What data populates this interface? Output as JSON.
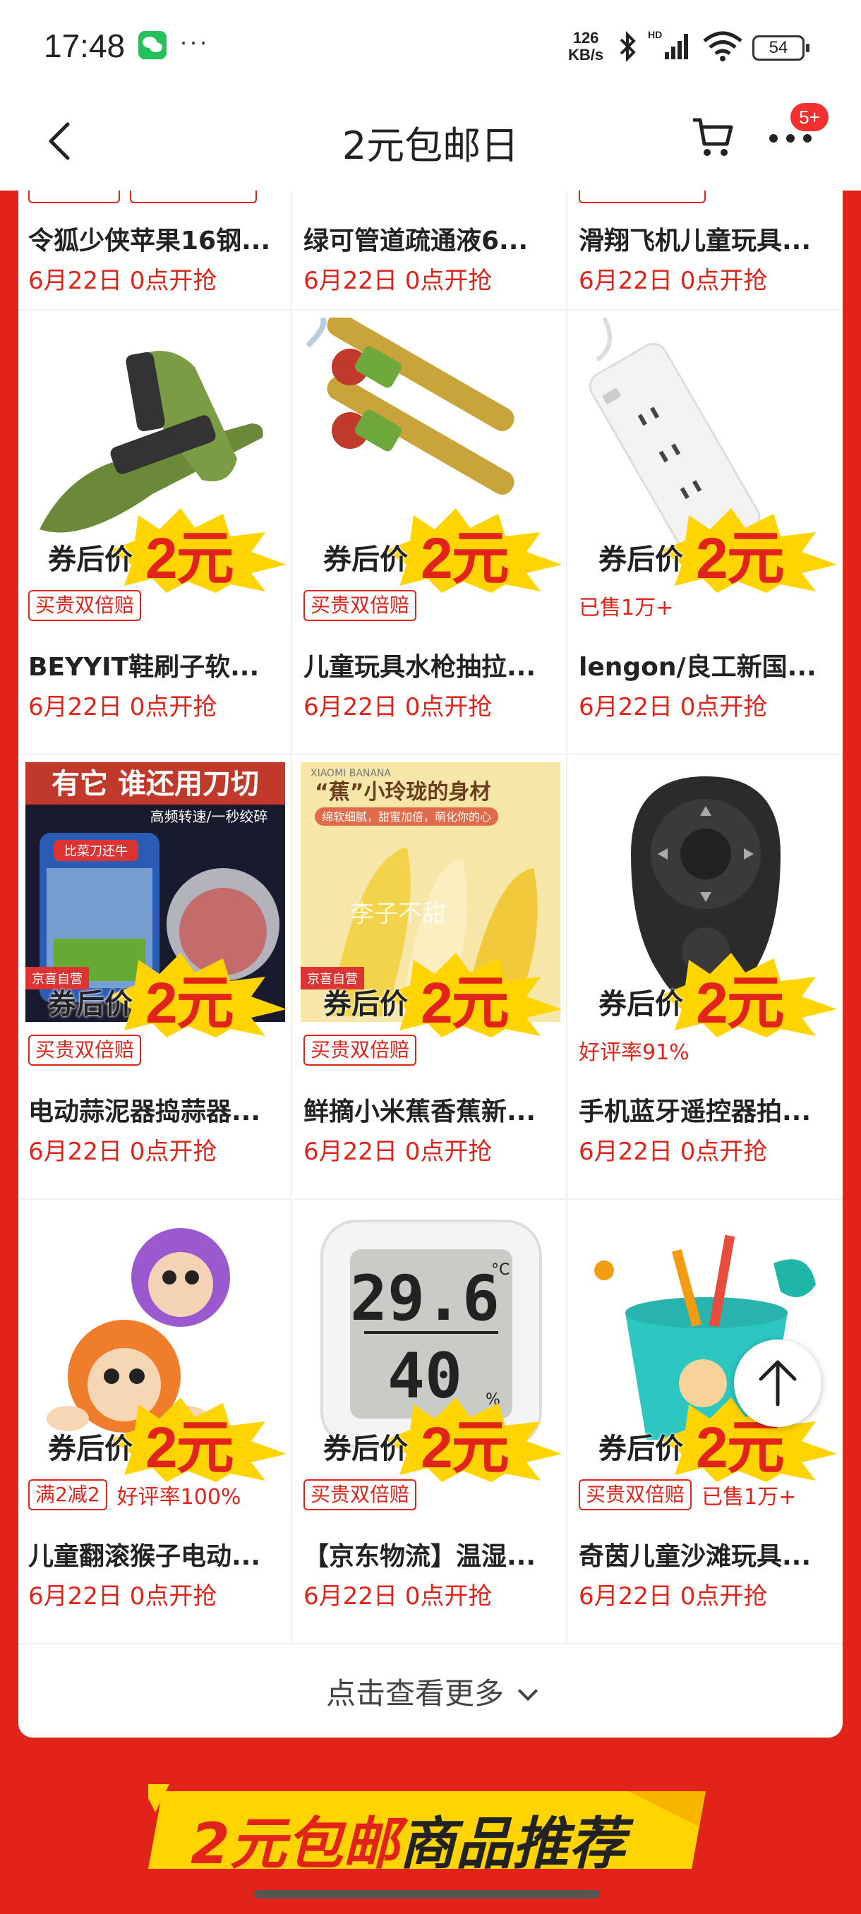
{
  "status_bar": {
    "time": "17:48",
    "network_speed_value": "126",
    "network_speed_unit": "KB/s",
    "battery": "54",
    "icons": [
      "wechat-icon",
      "more-dots-icon",
      "bluetooth-icon",
      "hd-signal-icon",
      "wifi-icon",
      "battery-icon"
    ]
  },
  "header": {
    "title": "2元包邮日",
    "cart_badge": "5+",
    "icons": [
      "back-icon",
      "cart-icon",
      "more-icon"
    ]
  },
  "price_label": "券后价",
  "price_value": "2元",
  "top_row": [
    {
      "name": "令狐少侠苹果16钢...",
      "date": "6月22日 0点开抢"
    },
    {
      "name": "绿可管道疏通液6...",
      "date": "6月22日 0点开抢"
    },
    {
      "name": "滑翔飞机儿童玩具...",
      "date": "6月22日 0点开抢"
    }
  ],
  "products": [
    {
      "tags_box": [
        "买贵双倍赔"
      ],
      "tags_text": [],
      "name": "BEYYIT鞋刷子软...",
      "date": "6月22日 0点开抢",
      "image": "shoe-brush"
    },
    {
      "tags_box": [
        "买贵双倍赔"
      ],
      "tags_text": [],
      "name": "儿童玩具水枪抽拉...",
      "date": "6月22日 0点开抢",
      "image": "water-gun"
    },
    {
      "tags_box": [],
      "tags_text": [
        "已售1万+"
      ],
      "name": "lengon/良工新国...",
      "date": "6月22日 0点开抢",
      "image": "power-strip"
    },
    {
      "tags_box": [
        "买贵双倍赔"
      ],
      "tags_text": [],
      "name": "电动蒜泥器捣蒜器...",
      "date": "6月22日 0点开抢",
      "image": "garlic-chopper"
    },
    {
      "tags_box": [
        "买贵双倍赔"
      ],
      "tags_text": [],
      "name": "鲜摘小米蕉香蕉新...",
      "date": "6月22日 0点开抢",
      "image": "banana"
    },
    {
      "tags_box": [],
      "tags_text": [
        "好评率91%"
      ],
      "name": "手机蓝牙遥控器拍...",
      "date": "6月22日 0点开抢",
      "image": "bluetooth-remote"
    },
    {
      "tags_box": [
        "满2减2"
      ],
      "tags_text": [
        "好评率100%"
      ],
      "name": "儿童翻滚猴子电动...",
      "date": "6月22日 0点开抢",
      "image": "toy-monkey"
    },
    {
      "tags_box": [
        "买贵双倍赔"
      ],
      "tags_text": [],
      "name": "【京东物流】温湿...",
      "date": "6月22日 0点开抢",
      "image": "thermometer"
    },
    {
      "tags_box": [
        "买贵双倍赔"
      ],
      "tags_text": [
        "已售1万+"
      ],
      "name": "奇茵儿童沙滩玩具...",
      "date": "6月22日 0点开抢",
      "image": "beach-toys"
    }
  ],
  "image_texts": {
    "garlic_headline": "有它 谁还用刀切",
    "garlic_sub": "高频转速/一秒绞碎",
    "garlic_label": "比菜刀还牛",
    "jd_self": "京喜自营",
    "banana_brand": "XIAOMI BANANA",
    "banana_headline": "“蕉”小玲珑的身材",
    "banana_sub": "绵软细腻，甜蜜加倍，萌化你的心",
    "banana_watermark": "李子不甜",
    "thermo_temp": "29.6",
    "thermo_temp_unit": "°C",
    "thermo_hum": "40",
    "thermo_hum_unit": "%"
  },
  "see_more": "点击查看更多",
  "banner": {
    "part1": "2元包邮",
    "part2": "商品推荐"
  },
  "colors": {
    "accent": "#e2231a",
    "price_star": "#ffd400",
    "text": "#222222"
  }
}
